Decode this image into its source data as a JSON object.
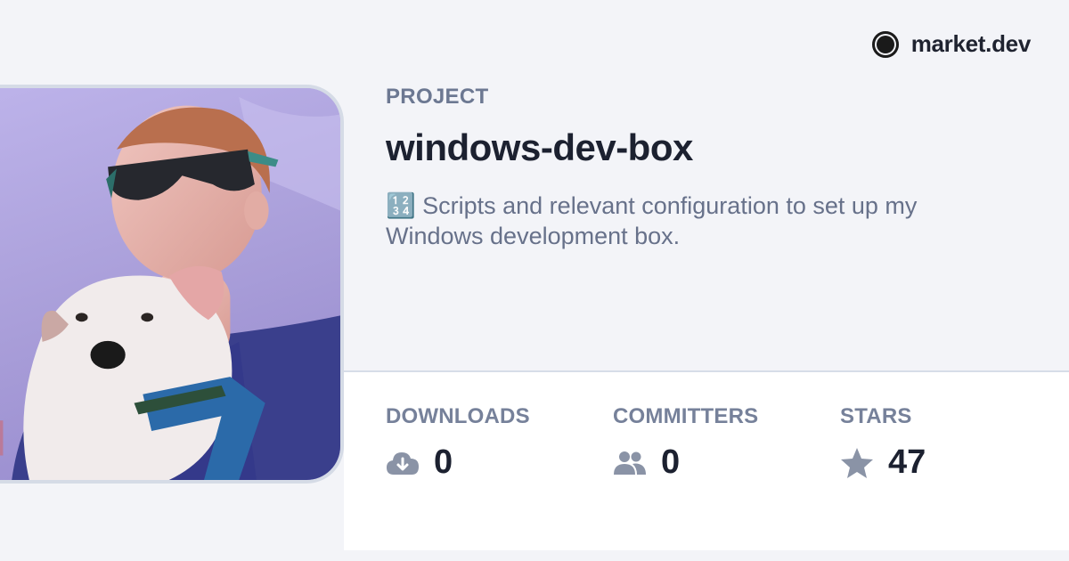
{
  "brand": {
    "name": "market.dev",
    "logo_icon": "circle-logo-icon"
  },
  "project": {
    "eyebrow": "PROJECT",
    "name": "windows-dev-box",
    "description": "🔢 Scripts and relevant configuration to set up my Windows development box."
  },
  "stats": [
    {
      "label": "DOWNLOADS",
      "value": "0",
      "icon": "cloud-download-icon"
    },
    {
      "label": "COMMITTERS",
      "value": "0",
      "icon": "people-icon"
    },
    {
      "label": "STARS",
      "value": "47",
      "icon": "star-icon"
    }
  ],
  "colors": {
    "background": "#f3f4f8",
    "panel": "#ffffff",
    "title": "#1c2130",
    "muted": "#6c7892",
    "icon": "#8a93a6"
  }
}
